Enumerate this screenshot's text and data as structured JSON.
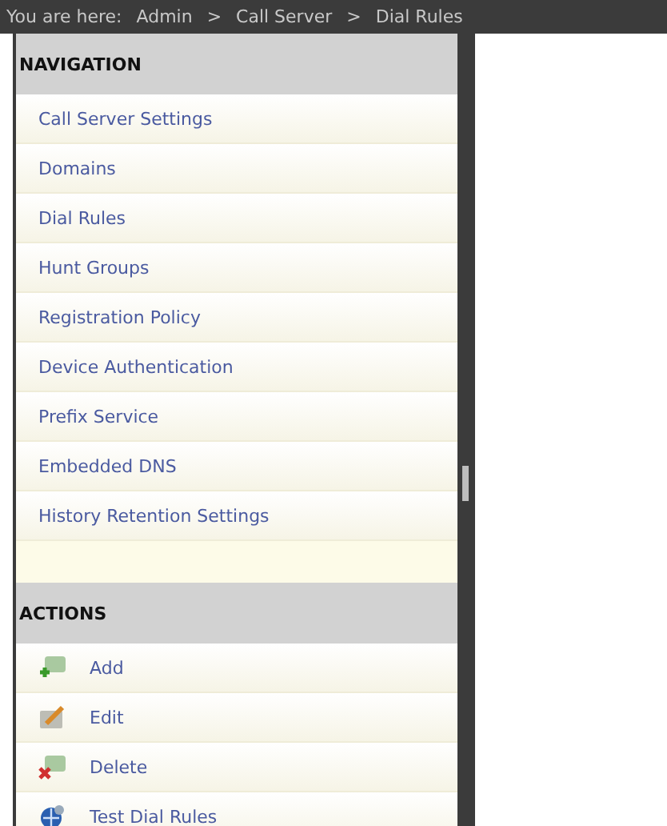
{
  "breadcrumb": {
    "label": "You are here:",
    "path": [
      "Admin",
      "Call Server",
      "Dial Rules"
    ],
    "separator": ">"
  },
  "navigation": {
    "title": "NAVIGATION",
    "items": [
      {
        "label": "Call Server Settings"
      },
      {
        "label": "Domains"
      },
      {
        "label": "Dial Rules"
      },
      {
        "label": "Hunt Groups"
      },
      {
        "label": "Registration Policy"
      },
      {
        "label": "Device Authentication"
      },
      {
        "label": "Prefix Service"
      },
      {
        "label": "Embedded DNS"
      },
      {
        "label": "History Retention Settings"
      }
    ]
  },
  "actions": {
    "title": "ACTIONS",
    "items": [
      {
        "label": "Add",
        "kind": "add"
      },
      {
        "label": "Edit",
        "kind": "edit"
      },
      {
        "label": "Delete",
        "kind": "delete"
      },
      {
        "label": "Test Dial Rules",
        "kind": "test"
      }
    ]
  }
}
